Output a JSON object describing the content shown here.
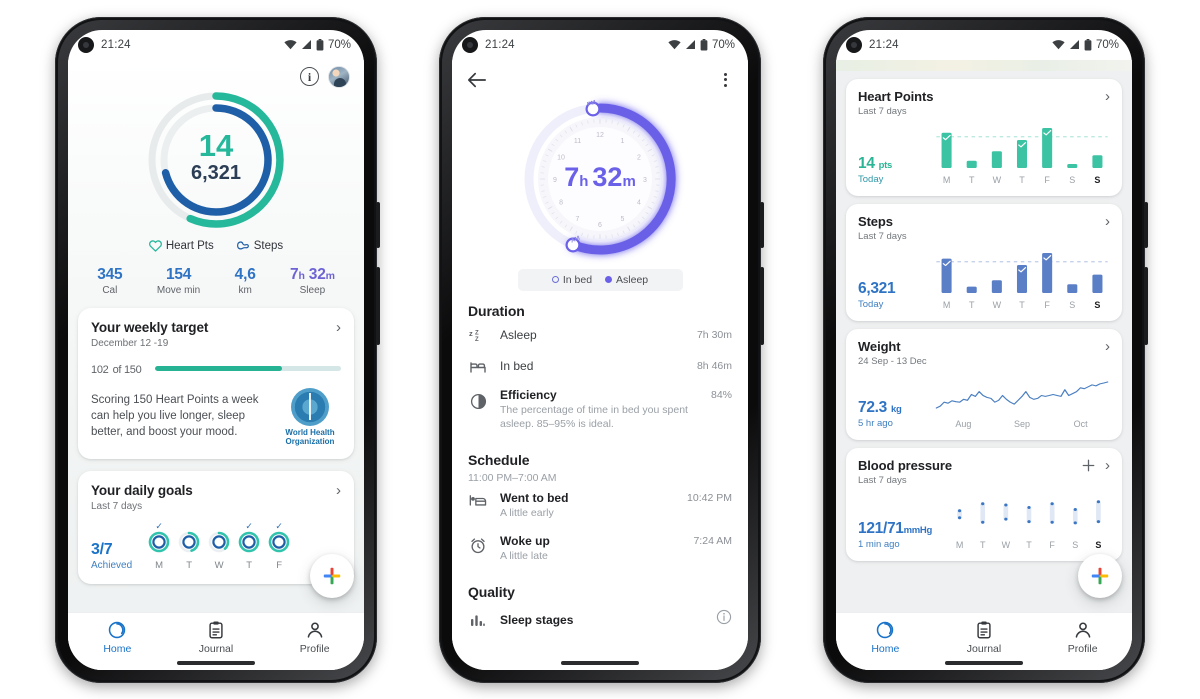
{
  "statusbar": {
    "time": "21:24",
    "battery": "70%",
    "wifi_icon": "wifi-icon",
    "signal_icon": "signal-icon",
    "battery_icon": "battery-icon"
  },
  "phone1": {
    "header": {
      "info_icon": "info-icon",
      "avatar": "user-avatar",
      "info_glyph": "i"
    },
    "ring": {
      "heart_points": "14",
      "steps": "6,321",
      "heart_color": "#26b89b",
      "steps_color": "#1f5fa8",
      "track_color": "#e4e8ea"
    },
    "legend": [
      {
        "label": "Heart Pts",
        "icon": "heart-icon",
        "color": "#26b89b"
      },
      {
        "label": "Steps",
        "icon": "shoe-icon",
        "color": "#1f5fa8"
      }
    ],
    "stats": [
      {
        "value": "345",
        "label": "Cal",
        "color": "#2f73c4"
      },
      {
        "value": "154",
        "label": "Move min",
        "color": "#2f73c4"
      },
      {
        "value": "4,6",
        "label": "km",
        "color": "#2f73c4"
      },
      {
        "value": "7",
        "unit1": "h",
        "value2": "32",
        "unit2": "m",
        "label": "Sleep",
        "color": "#6d63d4"
      }
    ],
    "weekly_target": {
      "title": "Your weekly target",
      "subtitle": "December 12 -19",
      "current": "102",
      "of_label": "of 150",
      "progress_pct": 68,
      "description": "Scoring 150 Heart Points a week can help you live longer, sleep better, and boost your mood.",
      "who_caption": "World Health\nOrganization",
      "who_line1": "World Health",
      "who_line2": "Organization",
      "chevron": "chevron-right-icon"
    },
    "daily_goals": {
      "title": "Your daily goals",
      "subtitle": "Last 7 days",
      "achieved": "3/7",
      "achieved_label": "Achieved",
      "days": [
        {
          "label": "M",
          "pct": 100,
          "check": true
        },
        {
          "label": "T",
          "pct": 45,
          "check": false
        },
        {
          "label": "W",
          "pct": 38,
          "check": false
        },
        {
          "label": "T",
          "pct": 100,
          "check": true
        },
        {
          "label": "F",
          "pct": 100,
          "check": true
        }
      ],
      "chevron": "chevron-right-icon"
    },
    "fab": {
      "icon": "google-plus-add-icon"
    },
    "nav": [
      {
        "label": "Home",
        "icon": "home-ring-icon",
        "active": true
      },
      {
        "label": "Journal",
        "icon": "clipboard-icon",
        "active": false
      },
      {
        "label": "Profile",
        "icon": "person-icon",
        "active": false
      }
    ]
  },
  "phone2": {
    "topbar": {
      "back_icon": "back-arrow-icon",
      "menu_icon": "more-vertical-icon"
    },
    "clock": {
      "duration_hours": "7",
      "h_unit": "h",
      "duration_mins": "32",
      "m_unit": "m",
      "color": "#6b61e8",
      "hour_labels": [
        "12",
        "1",
        "2",
        "3",
        "4",
        "5",
        "6",
        "7",
        "8",
        "9",
        "10",
        "11"
      ],
      "bedtime_marker": "PM",
      "waketime_marker": "AM"
    },
    "legend": [
      {
        "label": "In bed",
        "style": "outline"
      },
      {
        "label": "Asleep",
        "style": "filled"
      }
    ],
    "duration": {
      "title": "Duration",
      "rows": [
        {
          "icon": "zzz-icon",
          "name": "Asleep",
          "value": "7h 30m",
          "desc": ""
        },
        {
          "icon": "bed-icon",
          "name": "In bed",
          "value": "8h 46m",
          "desc": ""
        },
        {
          "icon": "pie-half-icon",
          "name": "Efficiency",
          "value": "84%",
          "desc": "The percentage of time in bed you spent asleep. 85–95% is ideal."
        }
      ]
    },
    "schedule": {
      "title": "Schedule",
      "window": "11:00 PM–7:00 AM",
      "rows": [
        {
          "icon": "bed-person-icon",
          "name": "Went to bed",
          "desc": "A little early",
          "value": "10:42 PM"
        },
        {
          "icon": "alarm-clock-icon",
          "name": "Woke up",
          "desc": "A little late",
          "value": "7:24 AM"
        }
      ]
    },
    "quality": {
      "title": "Quality",
      "rows": [
        {
          "icon": "bar-chart-icon",
          "name": "Sleep stages",
          "info_icon": "info-icon"
        }
      ]
    }
  },
  "phone3": {
    "cards": [
      {
        "title": "Heart Points",
        "subtitle": "Last 7 days",
        "value": "14",
        "unit": "pts",
        "when": "Today",
        "color": "#2bb596",
        "when_color": "#2f98a8",
        "chevron": "chevron-right-icon",
        "chart": {
          "type": "bar",
          "categories": [
            "M",
            "T",
            "W",
            "T",
            "F",
            "S",
            "S"
          ],
          "values": [
            88,
            18,
            42,
            70,
            100,
            10,
            32
          ],
          "goal_line": 78,
          "checks": [
            true,
            false,
            false,
            true,
            true,
            false,
            false
          ]
        }
      },
      {
        "title": "Steps",
        "subtitle": "Last 7 days",
        "value": "6,321",
        "unit": "",
        "when": "Today",
        "color": "#2f73c4",
        "when_color": "#3f7fc0",
        "chevron": "chevron-right-icon",
        "chart": {
          "type": "bar",
          "categories": [
            "M",
            "T",
            "W",
            "T",
            "F",
            "S",
            "S"
          ],
          "values": [
            86,
            16,
            32,
            70,
            100,
            22,
            46
          ],
          "goal_line": 78,
          "checks": [
            true,
            false,
            false,
            true,
            true,
            false,
            false
          ]
        }
      },
      {
        "title": "Weight",
        "subtitle": "24 Sep - 13 Dec",
        "value": "72.3",
        "unit": "kg",
        "when": "5 hr ago",
        "color": "#2f73c4",
        "when_color": "#3f7fc0",
        "chevron": "chevron-right-icon",
        "chart": {
          "type": "line",
          "xlabels": [
            "Aug",
            "Sep",
            "Oct"
          ],
          "values": [
            18,
            22,
            30,
            28,
            33,
            31,
            30,
            36,
            34,
            46,
            42,
            52,
            44,
            40,
            38,
            30,
            34,
            44,
            36,
            30,
            26,
            34,
            42,
            52,
            40,
            36,
            38,
            44,
            42,
            44,
            46,
            44,
            42,
            56,
            44,
            48,
            52,
            60,
            58,
            62,
            66,
            64,
            68,
            70,
            72
          ]
        }
      },
      {
        "title": "Blood pressure",
        "subtitle": "Last 7 days",
        "value": "121/71",
        "unit": "mmHg",
        "when": "1 min ago",
        "color": "#2f73c4",
        "when_color": "#3f7fc0",
        "add_icon": "plus-icon",
        "chevron": "chevron-right-icon",
        "chart": {
          "type": "range",
          "categories": [
            "M",
            "T",
            "W",
            "T",
            "F",
            "S",
            "S"
          ],
          "systolic": [
            62,
            84,
            80,
            72,
            84,
            66,
            90
          ],
          "diastolic": [
            30,
            16,
            26,
            18,
            16,
            14,
            18
          ]
        }
      }
    ],
    "fab": {
      "icon": "google-plus-add-icon"
    },
    "nav": [
      {
        "label": "Home",
        "icon": "home-ring-icon",
        "active": true
      },
      {
        "label": "Journal",
        "icon": "clipboard-icon",
        "active": false
      },
      {
        "label": "Profile",
        "icon": "person-icon",
        "active": false
      }
    ]
  }
}
